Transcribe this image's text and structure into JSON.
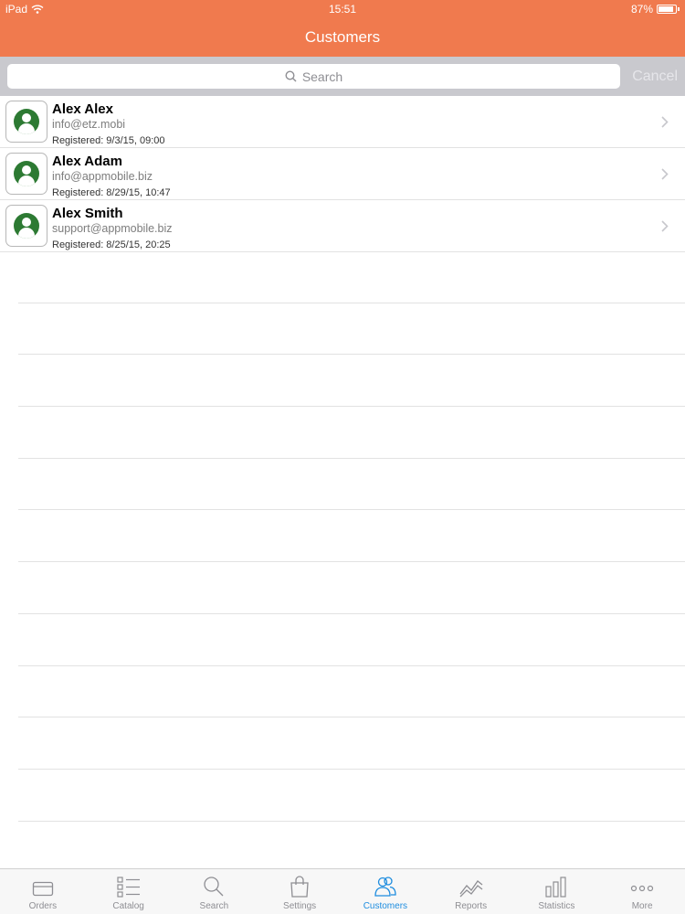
{
  "status_bar": {
    "device": "iPad",
    "time": "15:51",
    "battery": "87%",
    "battery_level": 0.87
  },
  "header": {
    "title": "Customers"
  },
  "search": {
    "placeholder": "Search",
    "cancel_label": "Cancel"
  },
  "customers": [
    {
      "name": "Alex Alex",
      "email": "info@etz.mobi",
      "registered": "Registered: 9/3/15, 09:00"
    },
    {
      "name": "Alex Adam",
      "email": "info@appmobile.biz",
      "registered": "Registered: 8/29/15, 10:47"
    },
    {
      "name": "Alex Smith",
      "email": "support@appmobile.biz",
      "registered": "Registered: 8/25/15, 20:25"
    }
  ],
  "tabs": [
    {
      "label": "Orders",
      "icon": "card-icon"
    },
    {
      "label": "Catalog",
      "icon": "checklist-icon"
    },
    {
      "label": "Search",
      "icon": "search-icon"
    },
    {
      "label": "Settings",
      "icon": "bag-icon"
    },
    {
      "label": "Customers",
      "icon": "users-icon",
      "active": true
    },
    {
      "label": "Reports",
      "icon": "trend-icon"
    },
    {
      "label": "Statistics",
      "icon": "bar-chart-icon"
    },
    {
      "label": "More",
      "icon": "ellipsis-icon"
    }
  ],
  "colors": {
    "accent": "#f07a4e",
    "active_tab": "#1e8ddf",
    "avatar": "#2d7a33"
  }
}
